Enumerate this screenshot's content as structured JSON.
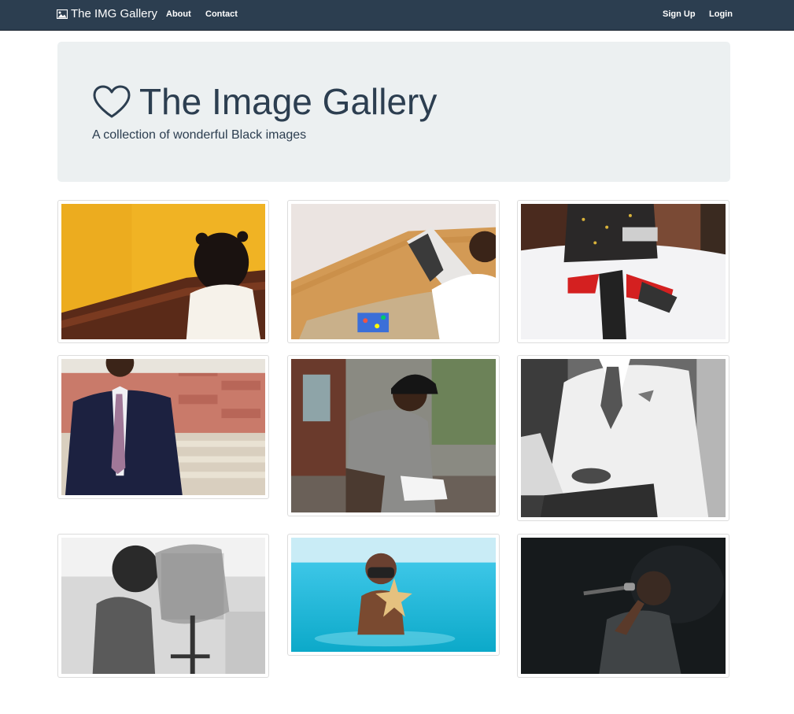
{
  "nav": {
    "brand": "The IMG Gallery",
    "brand_icon": "picture-icon",
    "about": "About",
    "contact": "Contact",
    "signup": "Sign Up",
    "login": "Login"
  },
  "hero": {
    "icon": "heart-icon",
    "title": "The Image Gallery",
    "subtitle": "A collection of wonderful Black images"
  },
  "colors": {
    "navbar": "#2c3e50",
    "jumbotron": "#ecf0f1",
    "text": "#2c3e50"
  }
}
